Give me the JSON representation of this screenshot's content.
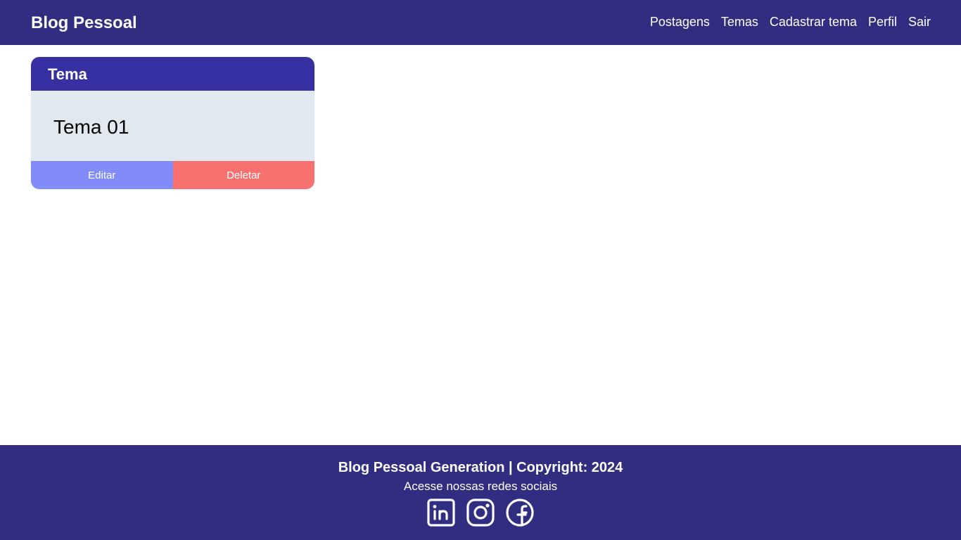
{
  "header": {
    "brand": "Blog Pessoal",
    "nav": [
      "Postagens",
      "Temas",
      "Cadastrar tema",
      "Perfil",
      "Sair"
    ]
  },
  "card": {
    "header": "Tema",
    "description": "Tema 01",
    "edit_label": "Editar",
    "delete_label": "Deletar"
  },
  "footer": {
    "title": "Blog Pessoal Generation | Copyright: 2024",
    "subtitle": "Acesse nossas redes sociais",
    "socials": [
      "linkedin-icon",
      "instagram-icon",
      "facebook-icon"
    ]
  },
  "colors": {
    "navbar": "#312e81",
    "card_header": "#3730a3",
    "card_body": "#e2e8f0",
    "edit_button": "#818cf8",
    "delete_button": "#f87171"
  }
}
